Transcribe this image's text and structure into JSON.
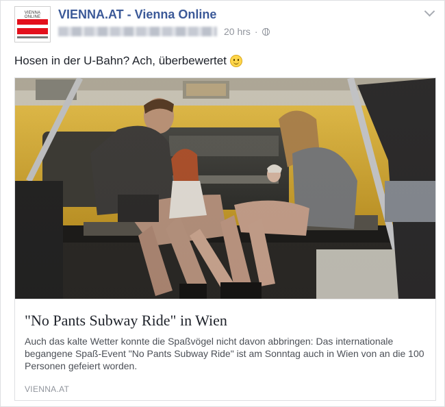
{
  "header": {
    "page_name": "VIENNA.AT - Vienna Online",
    "timestamp": "20 hrs",
    "separator": "·",
    "avatar_text": "VIENNA ONLINE",
    "privacy_icon": "globe-icon",
    "menu_icon": "chevron-down-icon"
  },
  "post": {
    "status_text": "Hosen in der U-Bahn? Ach, überbewertet",
    "emoji_icon": "smiley-icon"
  },
  "link_card": {
    "title": "\"No Pants Subway Ride\" in Wien",
    "description": "Auch das kalte Wetter konnte die Spaßvögel nicht davon abbringen: Das internationale begangene Spaß-Event \"No Pants Subway Ride\" ist am Sonntag auch in Wien von an die 100 Personen gefeiert worden.",
    "source": "VIENNA.AT"
  },
  "colors": {
    "link_blue": "#3b5998",
    "text_dark": "#1d2129",
    "text_grey": "#90949c",
    "brand_red": "#e3101c",
    "subway_yellow": "#e0b430"
  }
}
